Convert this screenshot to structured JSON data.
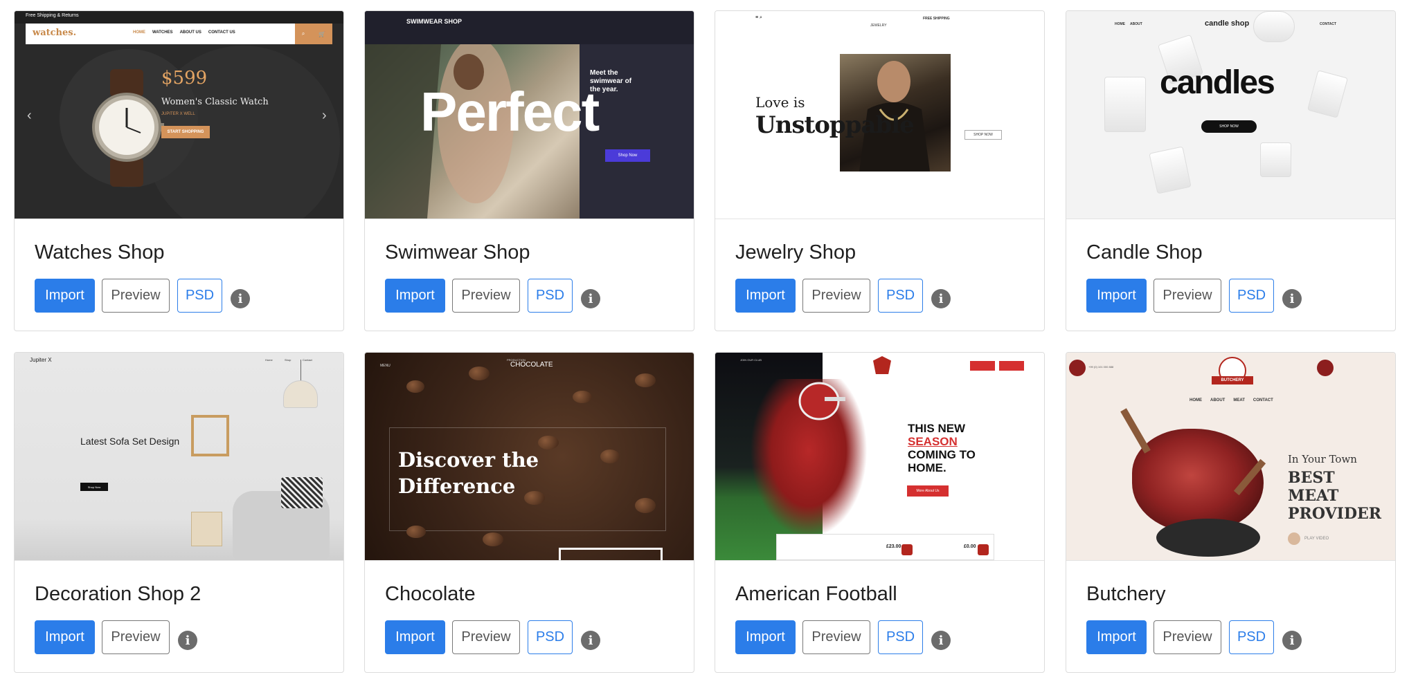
{
  "cards": [
    {
      "title": "Watches Shop",
      "thumb": {
        "topbar": "Free Shipping & Returns",
        "logo": "watches.",
        "nav": [
          "HOME",
          "WATCHES",
          "ABOUT US",
          "CONTACT US"
        ],
        "price": "$599",
        "product": "Women's Classic Watch",
        "subtitle": "JUPITER X WELL",
        "cta": "START SHOPPING",
        "cart": "0"
      }
    },
    {
      "title": "Swimwear Shop",
      "thumb": {
        "logo": "SWIMWEAR SHOP",
        "headline": "Perfect",
        "tagline": "Meet the swimwear of the year.",
        "cta": "Shop Now"
      }
    },
    {
      "title": "Jewelry Shop",
      "thumb": {
        "brand": "JEWELRY",
        "shipping": "FREE SHIPPING",
        "line1": "Love is",
        "line2": "Unstoppable",
        "cta": "SHOP NOW"
      }
    },
    {
      "title": "Candle Shop",
      "thumb": {
        "brand": "candle shop",
        "nav": [
          "HOME",
          "ABOUT",
          "CONTACT"
        ],
        "headline": "candles",
        "cta": "SHOP NOW"
      }
    },
    {
      "title": "Decoration Shop 2",
      "thumb": {
        "brand": "Jupiter X",
        "nav": [
          "Home",
          "Shop",
          "Contact"
        ],
        "headline": "Latest Sofa Set Design",
        "cta": "Shop Now"
      }
    },
    {
      "title": "Chocolate",
      "thumb": {
        "logo": "CHOCOLATE",
        "logo_small": "PRODUCTION",
        "headline": "Discover the Difference",
        "menu": "MENU"
      }
    },
    {
      "title": "American Football",
      "thumb": {
        "club": "JOIN OUR CLUB",
        "headline_a": "THIS NEW",
        "headline_b": "SEASON",
        "headline_c": "COMING TO HOME.",
        "cta": "More About Us",
        "prices": [
          "£23.00",
          "£0.00"
        ]
      }
    },
    {
      "title": "Butchery",
      "thumb": {
        "nav": [
          "HOME",
          "ABOUT",
          "MEAT",
          "CONTACT"
        ],
        "brand": "BUTCHERY",
        "phone": "+99 (0) 101 000 888",
        "tag": "In Your Town",
        "headline": "BEST MEAT PROVIDER",
        "play": "PLAY VIDEO"
      }
    }
  ],
  "buttons": {
    "import": "Import",
    "preview": "Preview",
    "psd": "PSD"
  },
  "icons": {
    "info": "info-icon"
  },
  "colors": {
    "primary": "#2b7de9",
    "info": "#6c6c6c"
  }
}
